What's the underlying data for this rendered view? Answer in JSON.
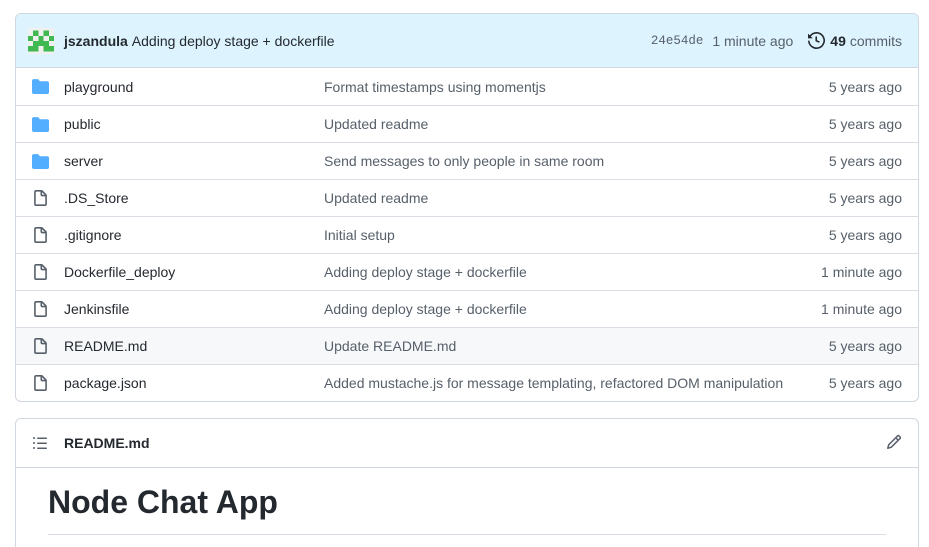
{
  "commit": {
    "author": "jszandula",
    "message": "Adding deploy stage + dockerfile",
    "sha": "24e54de",
    "time": "1 minute ago",
    "commits_count": "49",
    "commits_label": "commits"
  },
  "files": [
    {
      "name": "playground",
      "type": "folder",
      "message": "Format timestamps using momentjs",
      "age": "5 years ago"
    },
    {
      "name": "public",
      "type": "folder",
      "message": "Updated readme",
      "age": "5 years ago"
    },
    {
      "name": "server",
      "type": "folder",
      "message": "Send messages to only people in same room",
      "age": "5 years ago"
    },
    {
      "name": ".DS_Store",
      "type": "file",
      "message": "Updated readme",
      "age": "5 years ago"
    },
    {
      "name": ".gitignore",
      "type": "file",
      "message": "Initial setup",
      "age": "5 years ago"
    },
    {
      "name": "Dockerfile_deploy",
      "type": "file",
      "message": "Adding deploy stage + dockerfile",
      "age": "1 minute ago"
    },
    {
      "name": "Jenkinsfile",
      "type": "file",
      "message": "Adding deploy stage + dockerfile",
      "age": "1 minute ago"
    },
    {
      "name": "README.md",
      "type": "file",
      "message": "Update README.md",
      "age": "5 years ago"
    },
    {
      "name": "package.json",
      "type": "file",
      "message": "Added mustache.js for message templating, refactored DOM manipulation",
      "age": "5 years ago"
    }
  ],
  "readme": {
    "filename": "README.md",
    "heading": "Node Chat App"
  },
  "icons": {
    "folder": "folder-icon",
    "file": "file-icon",
    "history": "history-icon",
    "list": "list-icon",
    "edit": "pencil-icon"
  },
  "colors": {
    "header_bg": "#ddf4ff",
    "folder": "#54aeff",
    "avatar": "#3fb950"
  }
}
